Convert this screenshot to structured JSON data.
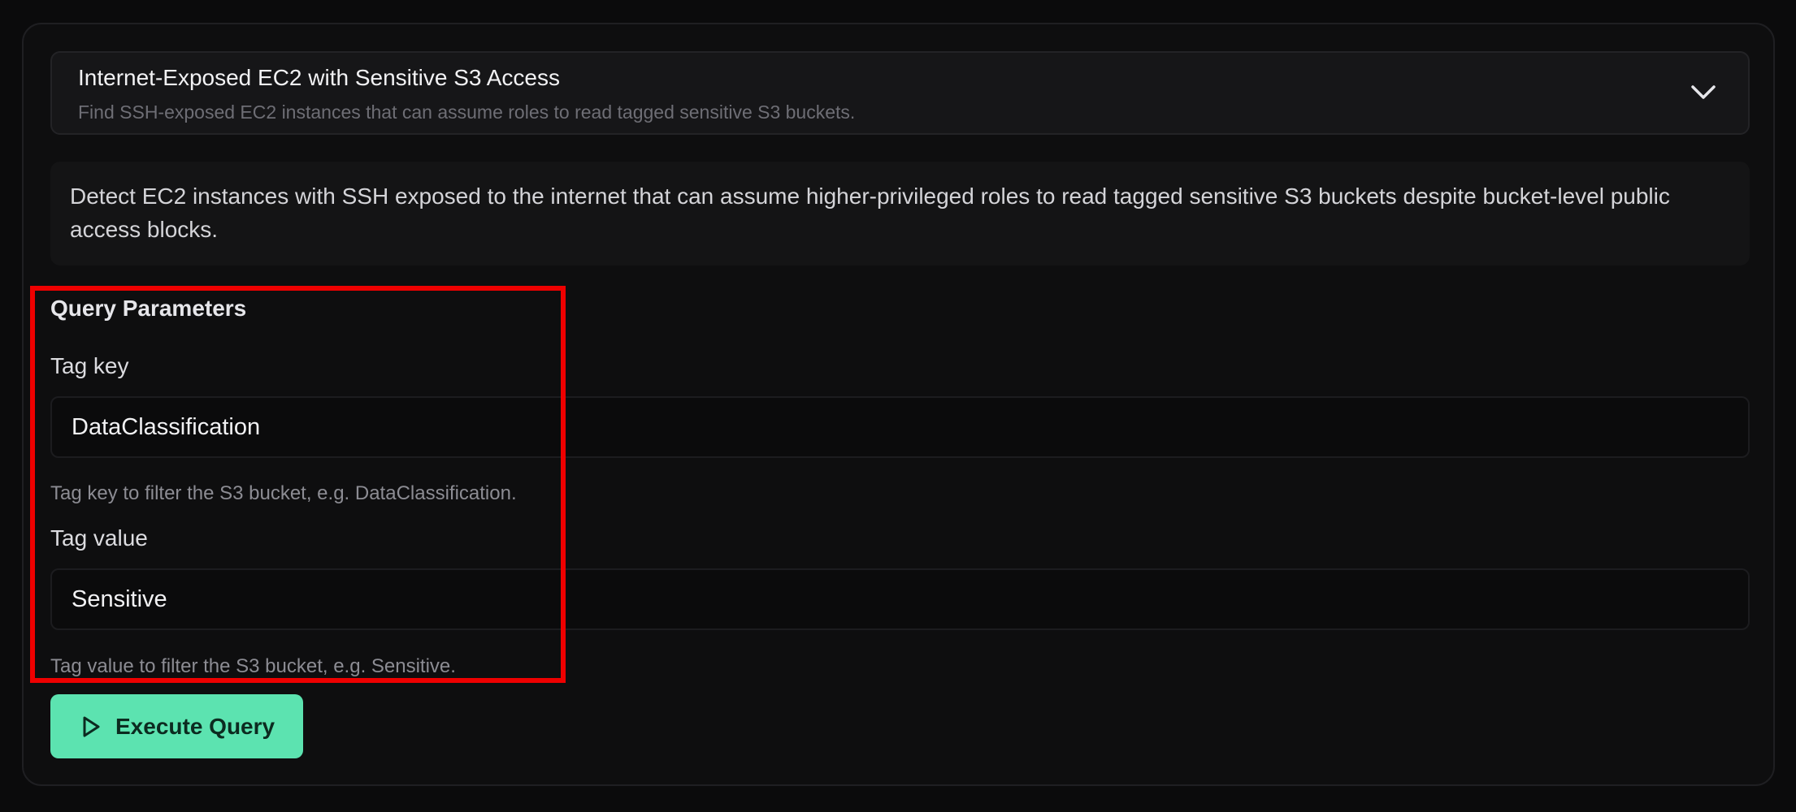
{
  "query": {
    "title": "Internet-Exposed EC2 with Sensitive S3 Access",
    "subtitle": "Find SSH-exposed EC2 instances that can assume roles to read tagged sensitive S3 buckets.",
    "description": "Detect EC2 instances with SSH exposed to the internet that can assume higher-privileged roles to read tagged sensitive S3 buckets despite bucket-level public access blocks."
  },
  "parameters": {
    "section_title": "Query Parameters",
    "tag_key": {
      "label": "Tag key",
      "value": "DataClassification",
      "hint": "Tag key to filter the S3 bucket, e.g. DataClassification."
    },
    "tag_value": {
      "label": "Tag value",
      "value": "Sensitive",
      "hint": "Tag value to filter the S3 bucket, e.g. Sensitive."
    }
  },
  "actions": {
    "execute_label": "Execute Query"
  },
  "icons": {
    "chevron": "chevron-down-icon",
    "play": "play-icon"
  },
  "colors": {
    "accent": "#5ce3b0",
    "highlight": "#ee0000",
    "background": "#0b0b0c"
  }
}
